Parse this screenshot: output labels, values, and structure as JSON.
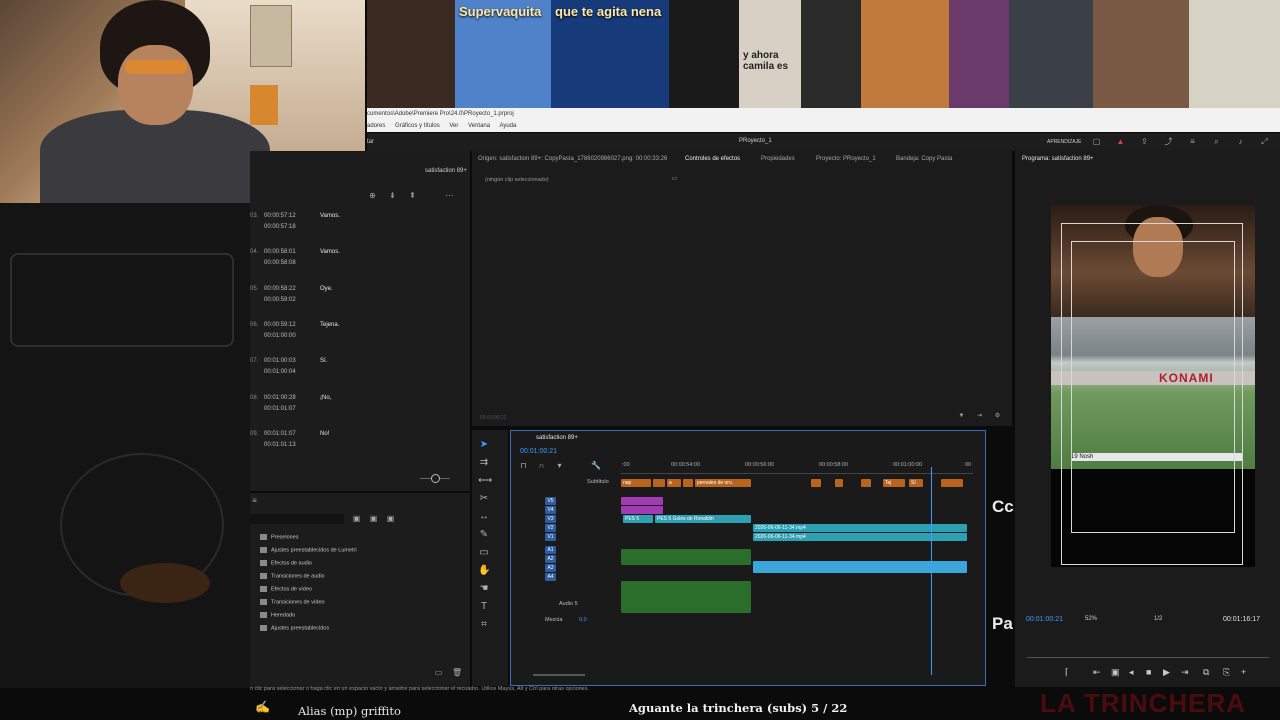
{
  "thumbnails": [
    {
      "label": "",
      "color": "#3a2a22"
    },
    {
      "label": "Supervaquita",
      "color": "#4f82c9"
    },
    {
      "label": "que te agita nena",
      "color": "#163a7a"
    },
    {
      "label": "",
      "color": "#1a1a1a"
    },
    {
      "label": "y ahora camila es",
      "color": "#d8d0c4"
    },
    {
      "label": "",
      "color": "#2a2a2a"
    },
    {
      "label": "",
      "color": "#c07a3c"
    },
    {
      "label": "",
      "color": "#6a3a6a"
    },
    {
      "label": "",
      "color": "#3a3f48"
    },
    {
      "label": "",
      "color": "#7a5a44"
    },
    {
      "label": "",
      "color": "#d6d2c4"
    }
  ],
  "explorer": {
    "path": "cumentos\\Adobe\\Premiere Pro\\24.0\\PRoyecto_1.prproj",
    "menu": [
      "adores",
      "Gráficos y títulos",
      "Ver",
      "Ventana",
      "Ayuda"
    ]
  },
  "app": {
    "title": "PRoyecto_1",
    "workspace": "APRENDIZAJE",
    "left_label": "tar"
  },
  "captions": {
    "tab": "satisfaction 89+",
    "rows": [
      {
        "num": "03.",
        "start": "00:00:57:12",
        "end": "00:00:57:18",
        "text": "Vamos."
      },
      {
        "num": "04.",
        "start": "00:00:58:01",
        "end": "00:00:58:08",
        "text": "Vamos."
      },
      {
        "num": "05.",
        "start": "00:00:58:22",
        "end": "00:00:59:02",
        "text": "Oye."
      },
      {
        "num": "06.",
        "start": "00:00:59:12",
        "end": "00:01:00:00",
        "text": "Tejena."
      },
      {
        "num": "07.",
        "start": "00:01:00:03",
        "end": "00:01:00:04",
        "text": "Sí."
      },
      {
        "num": "08.",
        "start": "00:01:00:28",
        "end": "00:01:01:07",
        "text": "¡No,"
      },
      {
        "num": "09.",
        "start": "00:01:01:07",
        "end": "00:01:01:13",
        "text": "No!"
      }
    ]
  },
  "effects": {
    "items": [
      "Preselones",
      "Ajustes preestablecidos de Lumetri",
      "Efectos de audio",
      "Transiciones de audio",
      "Efectos de vídeo",
      "Transiciones de vídeo",
      "Heredado",
      "Ajustes preestablecidos"
    ]
  },
  "source_panel": {
    "tabs": [
      "Origen: satisfaction 89+: CopyPasta_1786020986027.png: 00:00:33:26",
      "Controles de efectos",
      "Propiedades",
      "Proyecto: PRoyecto_1",
      "Bandeja: Copy Pasta"
    ],
    "no_clip": "(ningún clip seleccionado)",
    "time": "00:01:00:21"
  },
  "timeline": {
    "sequence": "satisfaction 89+",
    "timecode": "00:01:00:21",
    "ruler": [
      ":00",
      "00:00:54:00",
      "00:00:56:00",
      "00:00:58:00",
      "00:01:00:00",
      "00"
    ],
    "subtitle_track": "Subtítulo",
    "video_tracks": [
      "V5",
      "V4",
      "V3",
      "V2",
      "V1"
    ],
    "audio_tracks": [
      "A1",
      "A2",
      "A3",
      "A4"
    ],
    "audio5": "Audio 5",
    "mix_label": "Mezcla",
    "mix_value": "0,0",
    "sub_clips": [
      "nap",
      "a",
      "pernales de oro.",
      "Tej",
      "Sí"
    ],
    "v3_clips": [
      "PES 6",
      "PES 6 Goles de Ronaldin"
    ],
    "v1_clips": [
      "2026-06-06-11-34.mp4",
      "2026-06-06-11-34.mp4"
    ]
  },
  "program": {
    "tab": "Programa: satisfaction 89+",
    "timecode": "00:01:00:21",
    "zoom": "52%",
    "resolution": "1/2",
    "duration": "00:01:16:17",
    "game_brand": "KONAMI",
    "score": "19 Nosh"
  },
  "overlay_text": {
    "cc": "Cc",
    "pa": "Pa"
  },
  "status_text": "n clic para seleccionar o haga clic en un espacio vacío y arrastre para seleccionar el recuadro. Utilice Mayús, Alt y Ctrl para otras opciones.",
  "stream": {
    "alias": "Alias (mp) griffito",
    "now_playing": "Aguante la trinchera (subs) 5 / 22",
    "brand": "LA TRINCHERA"
  }
}
